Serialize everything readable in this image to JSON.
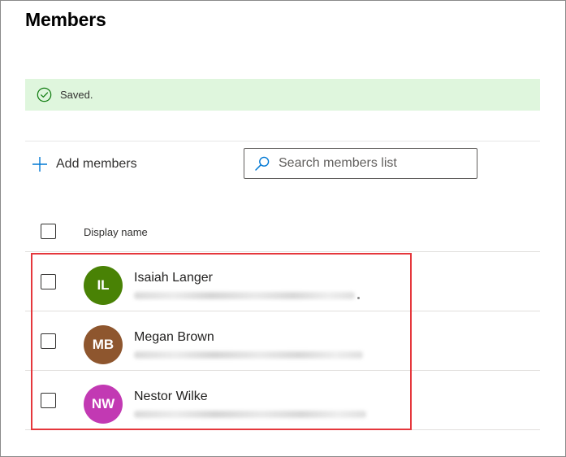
{
  "page": {
    "title": "Members"
  },
  "banner": {
    "text": "Saved.",
    "icon": "check-circle-icon",
    "bg_color": "#dff6dd",
    "icon_color": "#107c10"
  },
  "toolbar": {
    "add_label": "Add members",
    "add_icon": "plus-icon",
    "search_placeholder": "Search members list",
    "search_icon": "search-icon",
    "accent_color": "#0078d4"
  },
  "table": {
    "columns": [
      "Display name"
    ],
    "rows": [
      {
        "initials": "IL",
        "name": "Isaiah Langer",
        "avatar_color": "#498205"
      },
      {
        "initials": "MB",
        "name": "Megan Brown",
        "avatar_color": "#8e562e"
      },
      {
        "initials": "NW",
        "name": "Nestor Wilke",
        "avatar_color": "#c239b3"
      }
    ]
  },
  "highlight_color": "#e5373c"
}
